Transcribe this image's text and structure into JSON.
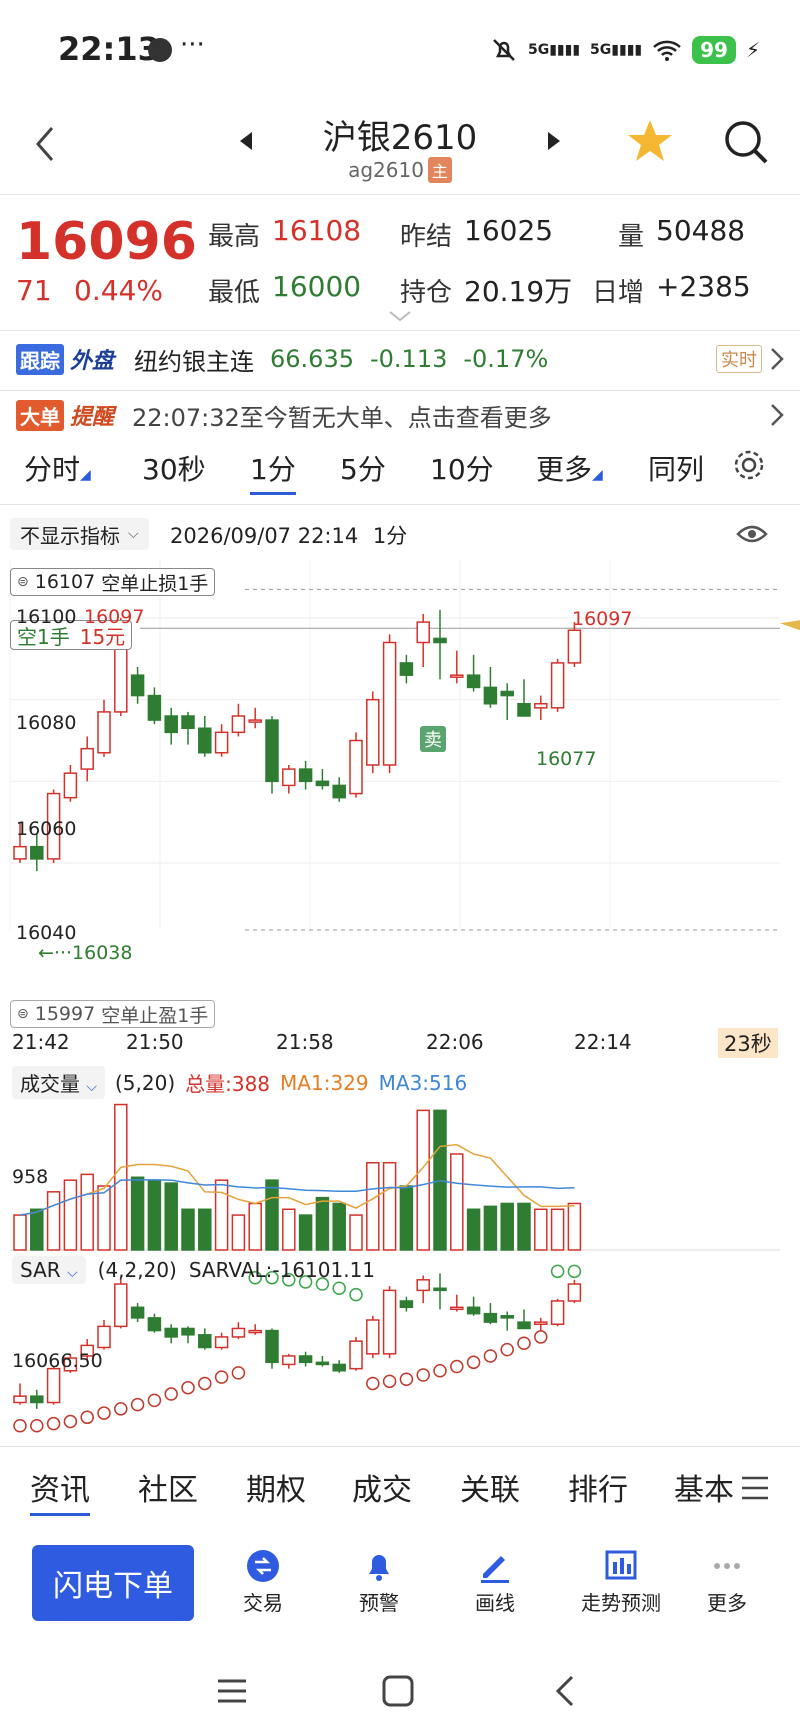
{
  "status": {
    "time": "22:13",
    "dots": "···",
    "signal1": "5G",
    "signal2": "5G",
    "battery": "99"
  },
  "header": {
    "title": "沪银2610",
    "code": "ag2610",
    "main_badge": "主"
  },
  "quote": {
    "price": "16096",
    "change": "71",
    "change_pct": "0.44%",
    "high_label": "最高",
    "high": "16108",
    "low_label": "最低",
    "low": "16000",
    "prev_label": "昨结",
    "prev": "16025",
    "oi_label": "持仓",
    "oi": "20.19万",
    "vol_label": "量",
    "vol": "50488",
    "inc_label": "日增",
    "inc": "+2385"
  },
  "outer": {
    "tag1": "跟踪",
    "tag2": "外盘",
    "name": "纽约银主连",
    "price": "66.635",
    "chg": "-0.113",
    "pct": "-0.17%",
    "realtime": "实时"
  },
  "alert": {
    "tag1": "大单",
    "tag2": "提醒",
    "text": "22:07:32至今暂无大单、点击查看更多"
  },
  "periods": [
    "分时",
    "30秒",
    "1分",
    "5分",
    "10分",
    "更多",
    "同列"
  ],
  "active_period": "1分",
  "chart_header": {
    "indicator": "不显示指标",
    "datetime": "2026/09/07 22:14",
    "period": "1分"
  },
  "orders": {
    "stop_loss": "16107",
    "stop_loss_text": "空单止损1手",
    "take_profit": "15997",
    "take_profit_text": "空单止盈1手",
    "position": "空1手",
    "pnl": "15元",
    "sell_tag": "卖"
  },
  "price_axis": [
    "16100",
    "16080",
    "16060",
    "16040"
  ],
  "annotations": {
    "max_left": "16097",
    "max_right": "16097",
    "min_left": "←···16038",
    "min_right": "16077"
  },
  "time_axis": [
    "21:42",
    "21:50",
    "21:58",
    "22:06",
    "22:14"
  ],
  "countdown": "23秒",
  "volume_header": {
    "label": "成交量",
    "params": "(5,20)",
    "total_label": "总量:388",
    "ma1": "MA1:329",
    "ma3": "MA3:516",
    "axis": "958"
  },
  "sar_header": {
    "label": "SAR",
    "params": "(4,2,20)",
    "val": "SARVAL:-16101.11",
    "axis": "16066.50"
  },
  "chart_data": {
    "type": "candlestick",
    "x": [
      "21:42",
      "21:43",
      "21:44",
      "21:45",
      "21:46",
      "21:47",
      "21:48",
      "21:49",
      "21:50",
      "21:51",
      "21:52",
      "21:53",
      "21:54",
      "21:55",
      "21:56",
      "21:57",
      "21:58",
      "21:59",
      "22:00",
      "22:01",
      "22:02",
      "22:03",
      "22:04",
      "22:05",
      "22:06",
      "22:07",
      "22:08",
      "22:09",
      "22:10",
      "22:11",
      "22:12",
      "22:13",
      "22:14",
      "22:15"
    ],
    "open": [
      16041,
      16044,
      16041,
      16056,
      16063,
      16067,
      16077,
      16086,
      16081,
      16076,
      16076,
      16073,
      16067,
      16072,
      16075,
      16075,
      16059,
      16063,
      16060,
      16059,
      16057,
      16064,
      16064,
      16089,
      16094,
      16095,
      16086,
      16086,
      16083,
      16082,
      16079,
      16078,
      16078,
      16089
    ],
    "close": [
      16044,
      16041,
      16057,
      16062,
      16068,
      16077,
      16097,
      16081,
      16075,
      16072,
      16073,
      16067,
      16072,
      16076,
      16075,
      16060,
      16063,
      16060,
      16059,
      16056,
      16070,
      16080,
      16094,
      16086,
      16099,
      16094,
      16086,
      16083,
      16079,
      16081,
      16076,
      16079,
      16089,
      16097
    ],
    "high": [
      16050,
      16047,
      16058,
      16064,
      16071,
      16080,
      16100,
      16088,
      16083,
      16078,
      16077,
      16076,
      16074,
      16079,
      16078,
      16076,
      16064,
      16065,
      16063,
      16061,
      16072,
      16082,
      16096,
      16091,
      16101,
      16102,
      16092,
      16091,
      16088,
      16084,
      16085,
      16081,
      16090,
      16099
    ],
    "low": [
      16040,
      16038,
      16040,
      16055,
      16060,
      16066,
      16076,
      16079,
      16074,
      16069,
      16069,
      16066,
      16066,
      16071,
      16073,
      16057,
      16057,
      16058,
      16058,
      16055,
      16056,
      16062,
      16062,
      16084,
      16088,
      16085,
      16084,
      16082,
      16078,
      16075,
      16076,
      16075,
      16077,
      16088
    ],
    "volume": [
      12,
      14,
      20,
      24,
      26,
      22,
      50,
      25,
      24,
      23,
      14,
      14,
      24,
      12,
      16,
      24,
      14,
      12,
      18,
      16,
      12,
      30,
      30,
      22,
      48,
      48,
      33,
      14,
      15,
      16,
      16,
      14,
      14,
      16
    ],
    "sar": [
      16030,
      16030,
      16031,
      16032,
      16034,
      16036,
      16038,
      16040,
      16042,
      16045,
      16048,
      16050,
      16053,
      16055,
      16100,
      16100,
      16099,
      16098,
      16097,
      16095,
      16092,
      16050,
      16051,
      16052,
      16054,
      16056,
      16058,
      16060,
      16063,
      16066,
      16069,
      16072,
      16103,
      16103,
      16102,
      16101
    ]
  },
  "bottom_tabs": [
    "资讯",
    "社区",
    "期权",
    "成交",
    "关联",
    "排行",
    "基本"
  ],
  "actions": {
    "flash": "闪电下单",
    "trade": "交易",
    "warn": "预警",
    "draw": "画线",
    "forecast": "走势预测",
    "more": "更多"
  },
  "colors": {
    "up": "#d4312b",
    "down": "#2e7d32",
    "accent": "#2c5bd6",
    "sar": "#c0392b"
  }
}
